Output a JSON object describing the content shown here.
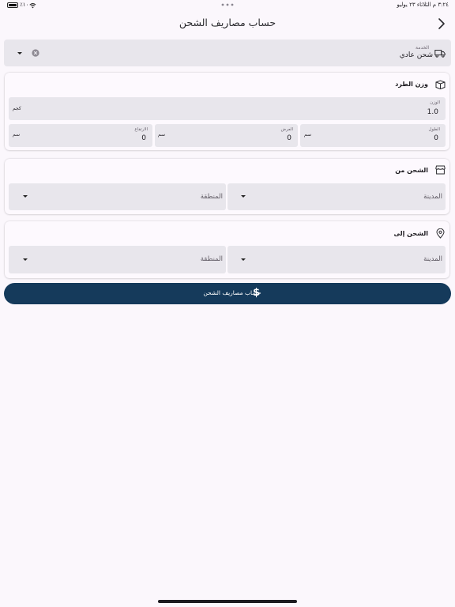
{
  "status_bar": {
    "time_date": "٣:٢٤ م  الثلاثاء ٢٣ يوليو",
    "battery": "٪١٠٠"
  },
  "header": {
    "title": "حساب مصاريف الشحن",
    "back_icon": "chevron-right-icon"
  },
  "service": {
    "label": "الخدمة",
    "value": "شحن عادي",
    "icon": "truck-icon"
  },
  "package_weight": {
    "title": "وزن الطرد",
    "weight": {
      "label": "الوزن",
      "value": "1.0",
      "unit": "كجم"
    },
    "length": {
      "label": "الطول",
      "value": "0",
      "unit": "سم"
    },
    "width": {
      "label": "العرض",
      "value": "0",
      "unit": "سم"
    },
    "height": {
      "label": "الارتفاع",
      "value": "0",
      "unit": "سم"
    }
  },
  "ship_from": {
    "title": "الشحن من",
    "city_placeholder": "المدينة",
    "region_placeholder": "المنطقة"
  },
  "ship_to": {
    "title": "الشحن إلى",
    "city_placeholder": "المدينة",
    "region_placeholder": "المنطقة"
  },
  "calculate_button": {
    "label": "حساب مصاريف الشحن",
    "icon": "dollar-icon"
  },
  "colors": {
    "background": "#fbf7fc",
    "field": "#e8e6ec",
    "primary_button": "#153a5b"
  }
}
